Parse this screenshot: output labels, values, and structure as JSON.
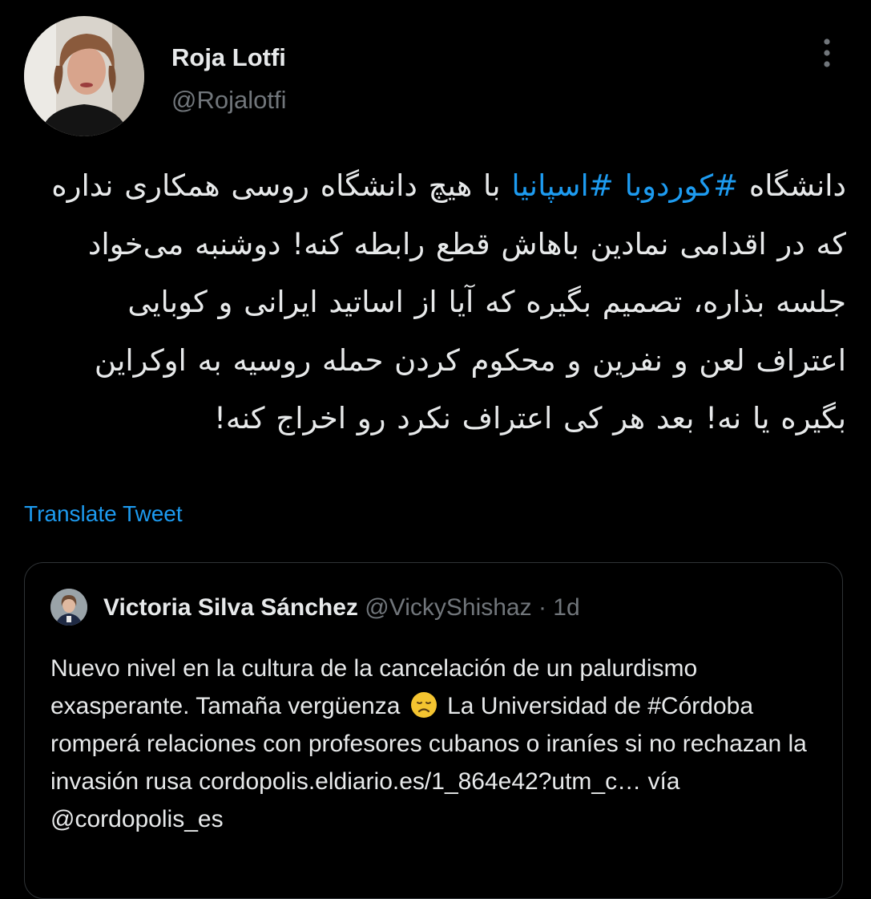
{
  "author": {
    "name": "Roja Lotfi",
    "handle": "@Rojalotfi"
  },
  "tweet": {
    "text_before": "دانشگاه ",
    "hashtag1": "#کوردوبا",
    "space1": " ",
    "hashtag2": "#اسپانیا",
    "text_after": " با هیچ دانشگاه روسی همکاری نداره که در اقدامی نمادین باهاش قطع رابطه کنه! دوشنبه می‌خواد جلسه بذاره، تصمیم بگیره که آیا از اساتید ایرانی و کوبایی اعتراف لعن و نفرین و محکوم کردن حمله روسیه به اوکراین بگیره یا نه! بعد هر کی اعتراف نکرد رو اخراج کنه!"
  },
  "translate_label": "Translate Tweet",
  "quoted": {
    "name": "Victoria Silva Sánchez",
    "handle": "@VickyShishaz",
    "separator": "·",
    "time": "1d",
    "text_part1": "Nuevo nivel en la cultura de la cancelación de un palurdismo exasperante. Tamaña vergüenza",
    "emoji": "disappointed-face-icon",
    "text_part2": "La Universidad de #Córdoba romperá relaciones con profesores cubanos o iraníes si no rechazan la invasión rusa cordopolis.eldiario.es/1_864e42?utm_c… vía @cordopolis_es"
  },
  "colors": {
    "background": "#000000",
    "text_primary": "#e7e9ea",
    "text_secondary": "#71767b",
    "accent": "#1d9bf0",
    "border": "#2f3336"
  }
}
